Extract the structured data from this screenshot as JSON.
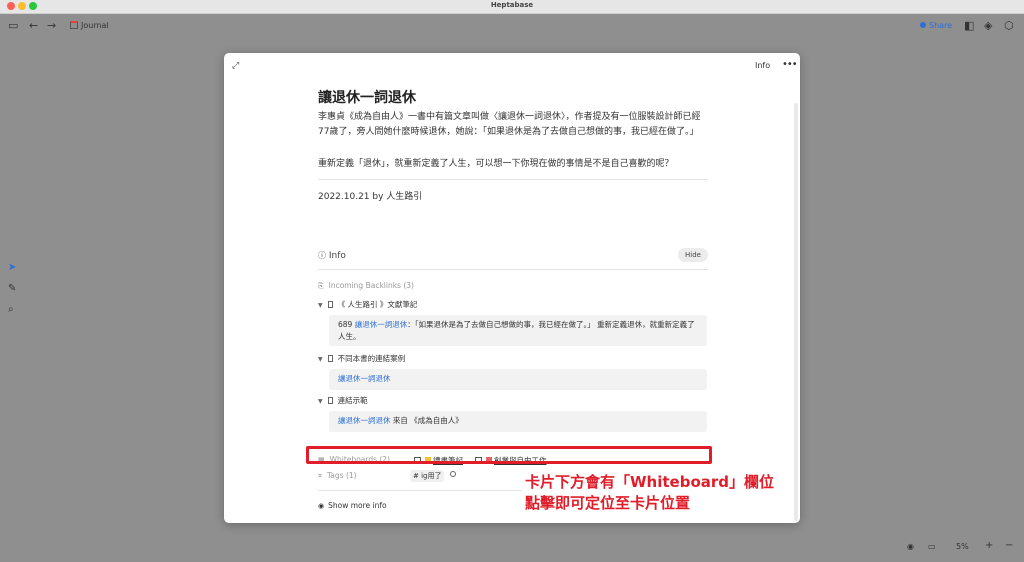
{
  "window": {
    "title": "Heptabase"
  },
  "toolbar": {
    "journal_label": "Journal",
    "share_label": "Share"
  },
  "card": {
    "top_info_label": "Info",
    "title": "讓退休一詞退休",
    "para1": "李惠貞《成為自由人》一書中有篇文章叫做〈讓退休一詞退休〉，作者提及有一位服裝設計師已經77歲了，旁人問她什麼時候退休，她說：「如果退休是為了去做自己想做的事，我已經在做了。」",
    "para2": "重新定義「退休」，就重新定義了人生，可以想一下你現在做的事情是不是自己喜歡的呢？",
    "date_line": "2022.10.21 by 人生路引"
  },
  "info": {
    "heading": "Info",
    "hide_label": "Hide",
    "incoming_label": "Incoming Backlinks (3)",
    "backlinks": [
      {
        "title": "《 人生路引 》文獻筆記",
        "prefix": "689 ",
        "link": "讓退休一詞退休",
        "text": "：「如果退休是為了去做自己想做的事，我已經在做了。」 重新定義退休，就重新定義了人生。"
      },
      {
        "title": "不同本書的連結案例",
        "prefix": "",
        "link": "讓退休一詞退休",
        "text": ""
      },
      {
        "title": "連結示範",
        "prefix": "",
        "link": "讓退休一詞退休",
        "text": " 來自 《成為自由人》"
      }
    ],
    "whiteboards_label": "Whiteboards (2)",
    "whiteboards": [
      "讀書筆記",
      "創業與自由工作"
    ],
    "tags_label": "Tags (1)",
    "tags": [
      "ig用了"
    ],
    "show_more_label": "Show more info"
  },
  "annotation": {
    "line1": "卡片下方會有「Whiteboard」欄位",
    "line2": "點擊即可定位至卡片位置",
    "color": "#e11d2a"
  },
  "bottom": {
    "zoom": "5%"
  }
}
